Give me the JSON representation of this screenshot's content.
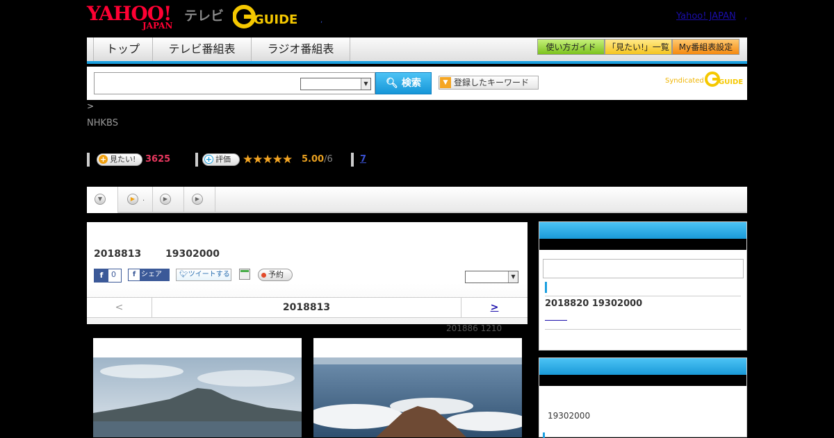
{
  "header": {
    "yahoo_logo": "YAHOO!",
    "japan_logo": "JAPAN",
    "tv_label": "テレビ",
    "gguide_logo": "GUIDE",
    "yahoo_japan_link": "Yahoo! JAPAN"
  },
  "nav": {
    "tabs": [
      "トップ",
      "テレビ番組表",
      "ラジオ番組表"
    ],
    "right_buttons": [
      "使い方ガイド",
      "「見たい!」一覧",
      "My番組表設定"
    ]
  },
  "search": {
    "input_value": "",
    "select_value": "",
    "button_label": "検索",
    "keyword_button": "登録したキーワード",
    "syndicated": "Syndicated"
  },
  "breadcrumb": ">",
  "program": {
    "channel": "NHKBS",
    "want_label": "見たい!",
    "want_count": "3625",
    "rate_label": "評価",
    "stars": "★★★★★",
    "score": "5.00",
    "score_of": "/6",
    "review_count": "7"
  },
  "tabstrip": {
    "tab2_dot": "."
  },
  "main": {
    "date": "2018813",
    "time": "19302000",
    "fb_like_count": "0",
    "fb_share": "シェア",
    "tweet": "ツイートする",
    "reserve": "予約",
    "select_value": "",
    "prev": "<",
    "current_date": "2018813",
    "next": ">",
    "updated": "201886  1210"
  },
  "sidebar": {
    "next_broadcast": "2018820  19302000",
    "second_time": "19302000"
  },
  "colors": {
    "accent_blue": "#1ba0e0",
    "want_red": "#e8385f",
    "star_gold": "#f5a623"
  }
}
